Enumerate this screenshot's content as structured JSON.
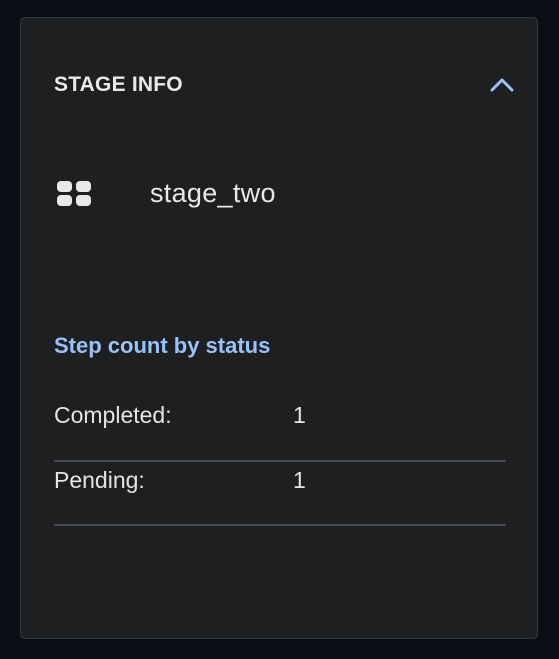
{
  "panel": {
    "title": "STAGE INFO",
    "collapse_icon": "chevron-up-icon"
  },
  "stage": {
    "icon": "grid-icon",
    "name": "stage_two"
  },
  "step_counts": {
    "heading": "Step count by status",
    "rows": [
      {
        "label": "Completed:",
        "value": "1"
      },
      {
        "label": "Pending:",
        "value": "1"
      }
    ]
  },
  "colors": {
    "page_background": "#0b0e14",
    "panel_background": "#1e1f20",
    "accent": "#9ac2f8",
    "text": "#e8e8e8",
    "divider": "#46494d"
  }
}
